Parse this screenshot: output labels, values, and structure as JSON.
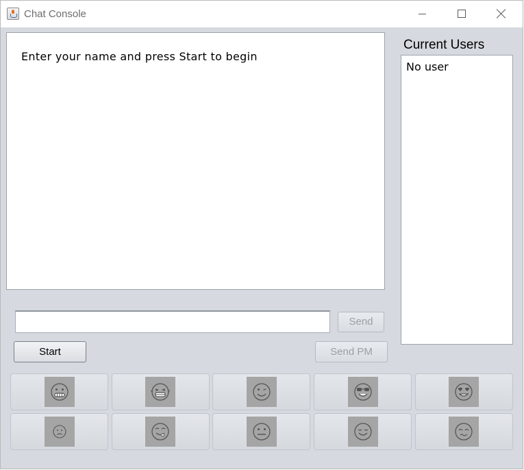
{
  "window": {
    "title": "Chat Console"
  },
  "chat": {
    "message": "Enter your name and press Start to begin"
  },
  "users": {
    "title": "Current Users",
    "items": [
      "No user"
    ]
  },
  "input": {
    "value": "",
    "placeholder": ""
  },
  "buttons": {
    "send": "Send",
    "send_pm": "Send PM",
    "start": "Start"
  },
  "emojis": [
    {
      "icon": "grinning-face-icon"
    },
    {
      "icon": "laughing-face-icon"
    },
    {
      "icon": "winking-face-icon"
    },
    {
      "icon": "sunglasses-face-icon"
    },
    {
      "icon": "heart-eyes-face-icon"
    },
    {
      "icon": "sad-face-icon"
    },
    {
      "icon": "tongue-out-face-icon"
    },
    {
      "icon": "neutral-face-icon"
    },
    {
      "icon": "relieved-face-icon"
    },
    {
      "icon": "embarrassed-face-icon"
    }
  ]
}
